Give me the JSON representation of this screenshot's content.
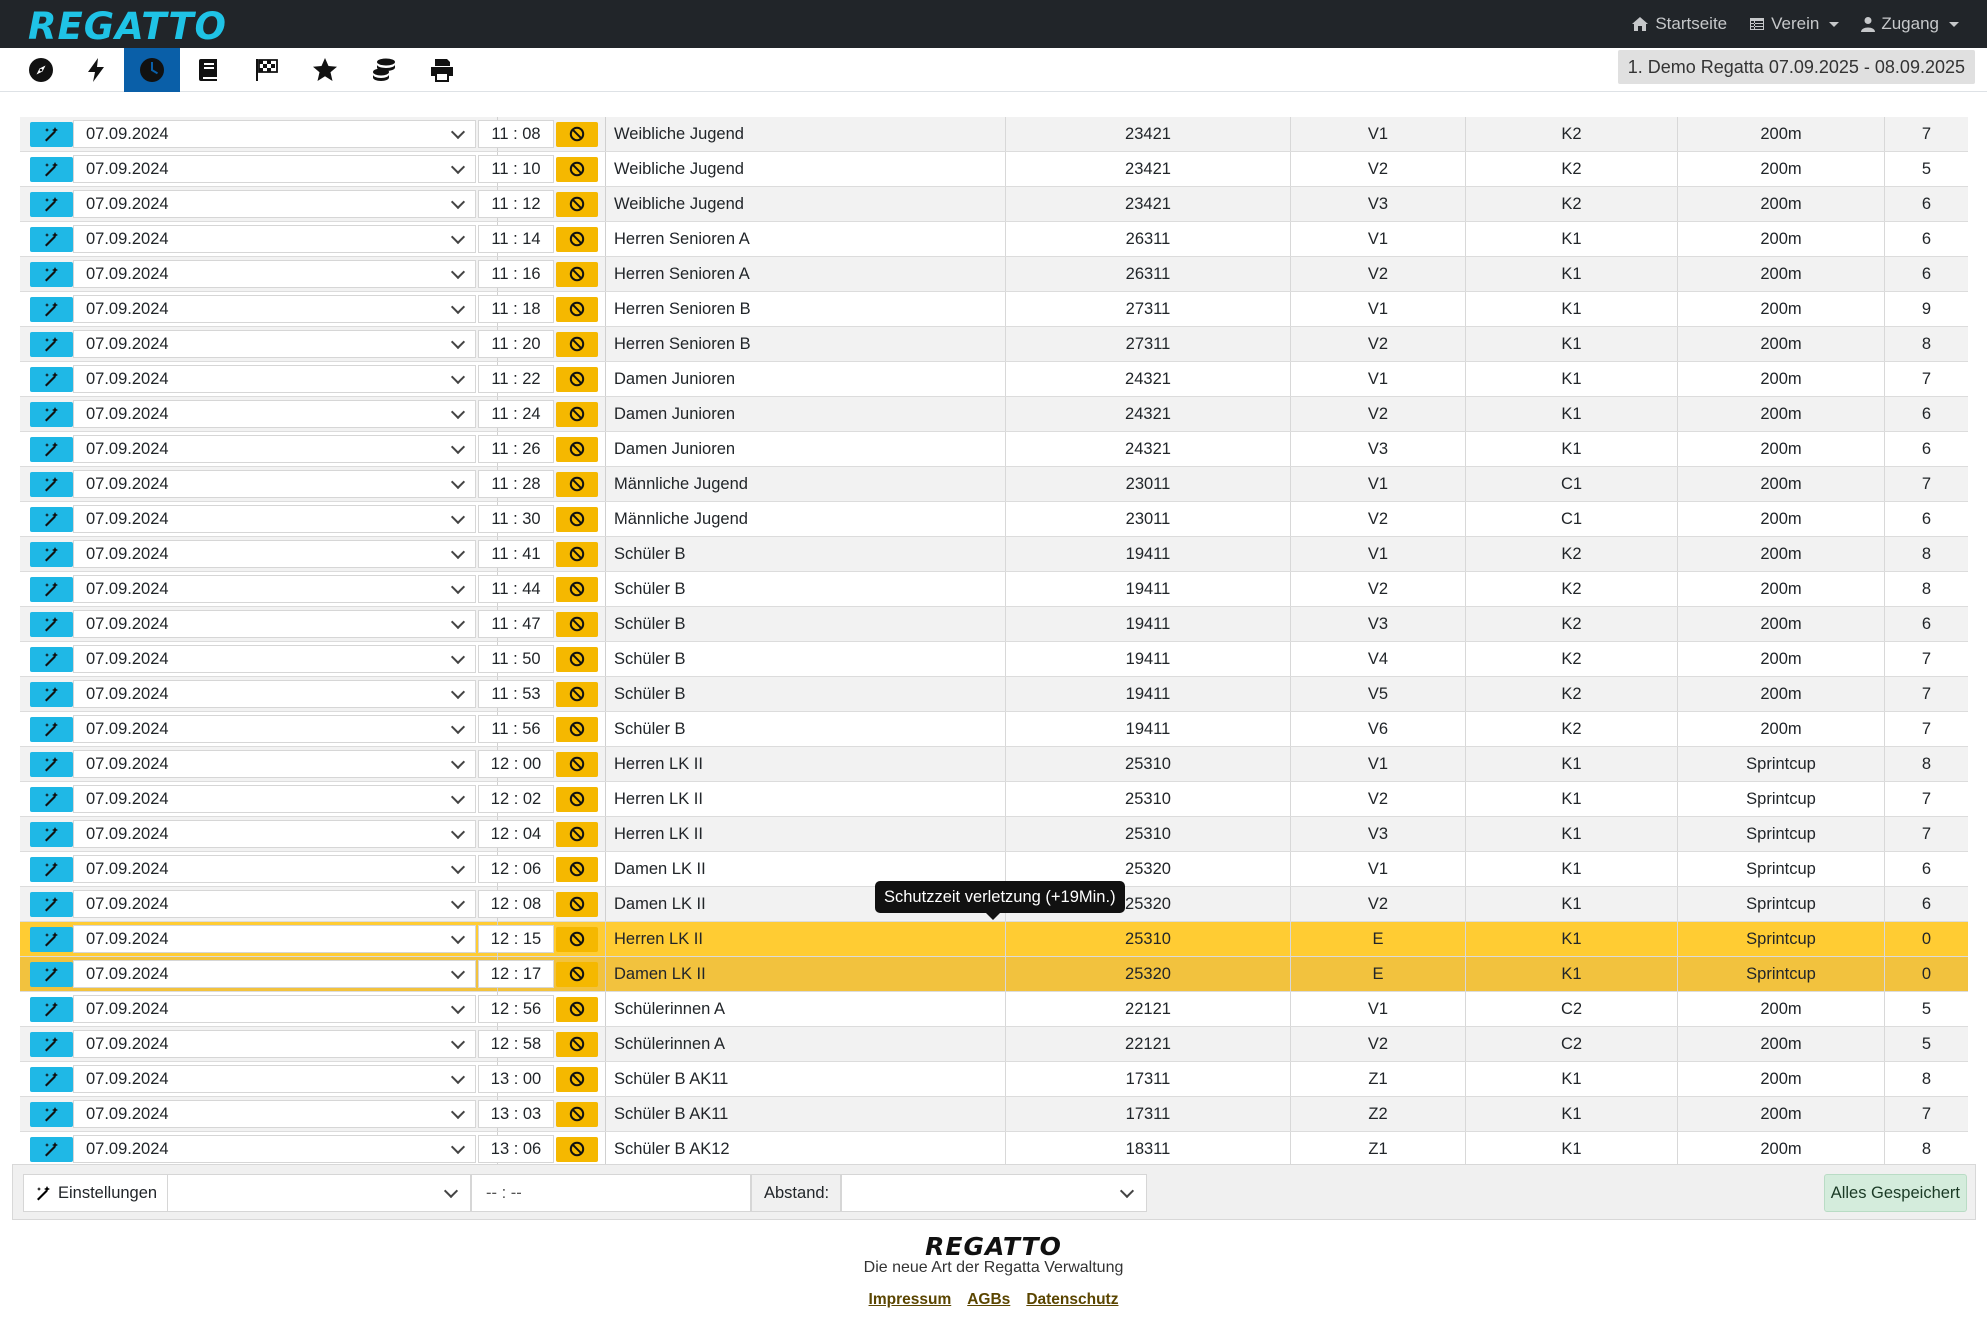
{
  "app": {
    "brand": "REGATTO"
  },
  "nav": {
    "links": [
      {
        "label": "Startseite",
        "icon": "home-icon",
        "has_caret": false
      },
      {
        "label": "Verein",
        "icon": "table-icon",
        "has_caret": true
      },
      {
        "label": "Zugang",
        "icon": "user-icon",
        "has_caret": true
      }
    ]
  },
  "toolbar": {
    "icons": [
      "compass-icon",
      "bolt-icon",
      "clock-icon",
      "book-icon",
      "checkered-flag-icon",
      "star-icon",
      "coins-icon",
      "print-icon"
    ],
    "active_index": 2,
    "regatta_label": "1. Demo Regatta 07.09.2025 - 08.09.2025"
  },
  "rows": [
    {
      "date": "07.09.2024",
      "time": "11 : 08",
      "name": "Weibliche Jugend",
      "number": "23421",
      "lauf": "V1",
      "klasse": "K2",
      "distance": "200m",
      "count": "7"
    },
    {
      "date": "07.09.2024",
      "time": "11 : 10",
      "name": "Weibliche Jugend",
      "number": "23421",
      "lauf": "V2",
      "klasse": "K2",
      "distance": "200m",
      "count": "5"
    },
    {
      "date": "07.09.2024",
      "time": "11 : 12",
      "name": "Weibliche Jugend",
      "number": "23421",
      "lauf": "V3",
      "klasse": "K2",
      "distance": "200m",
      "count": "6"
    },
    {
      "date": "07.09.2024",
      "time": "11 : 14",
      "name": "Herren Senioren A",
      "number": "26311",
      "lauf": "V1",
      "klasse": "K1",
      "distance": "200m",
      "count": "6"
    },
    {
      "date": "07.09.2024",
      "time": "11 : 16",
      "name": "Herren Senioren A",
      "number": "26311",
      "lauf": "V2",
      "klasse": "K1",
      "distance": "200m",
      "count": "6"
    },
    {
      "date": "07.09.2024",
      "time": "11 : 18",
      "name": "Herren Senioren B",
      "number": "27311",
      "lauf": "V1",
      "klasse": "K1",
      "distance": "200m",
      "count": "9"
    },
    {
      "date": "07.09.2024",
      "time": "11 : 20",
      "name": "Herren Senioren B",
      "number": "27311",
      "lauf": "V2",
      "klasse": "K1",
      "distance": "200m",
      "count": "8"
    },
    {
      "date": "07.09.2024",
      "time": "11 : 22",
      "name": "Damen Junioren",
      "number": "24321",
      "lauf": "V1",
      "klasse": "K1",
      "distance": "200m",
      "count": "7"
    },
    {
      "date": "07.09.2024",
      "time": "11 : 24",
      "name": "Damen Junioren",
      "number": "24321",
      "lauf": "V2",
      "klasse": "K1",
      "distance": "200m",
      "count": "6"
    },
    {
      "date": "07.09.2024",
      "time": "11 : 26",
      "name": "Damen Junioren",
      "number": "24321",
      "lauf": "V3",
      "klasse": "K1",
      "distance": "200m",
      "count": "6"
    },
    {
      "date": "07.09.2024",
      "time": "11 : 28",
      "name": "Männliche Jugend",
      "number": "23011",
      "lauf": "V1",
      "klasse": "C1",
      "distance": "200m",
      "count": "7"
    },
    {
      "date": "07.09.2024",
      "time": "11 : 30",
      "name": "Männliche Jugend",
      "number": "23011",
      "lauf": "V2",
      "klasse": "C1",
      "distance": "200m",
      "count": "6"
    },
    {
      "date": "07.09.2024",
      "time": "11 : 41",
      "name": "Schüler B",
      "number": "19411",
      "lauf": "V1",
      "klasse": "K2",
      "distance": "200m",
      "count": "8"
    },
    {
      "date": "07.09.2024",
      "time": "11 : 44",
      "name": "Schüler B",
      "number": "19411",
      "lauf": "V2",
      "klasse": "K2",
      "distance": "200m",
      "count": "8"
    },
    {
      "date": "07.09.2024",
      "time": "11 : 47",
      "name": "Schüler B",
      "number": "19411",
      "lauf": "V3",
      "klasse": "K2",
      "distance": "200m",
      "count": "6"
    },
    {
      "date": "07.09.2024",
      "time": "11 : 50",
      "name": "Schüler B",
      "number": "19411",
      "lauf": "V4",
      "klasse": "K2",
      "distance": "200m",
      "count": "7"
    },
    {
      "date": "07.09.2024",
      "time": "11 : 53",
      "name": "Schüler B",
      "number": "19411",
      "lauf": "V5",
      "klasse": "K2",
      "distance": "200m",
      "count": "7"
    },
    {
      "date": "07.09.2024",
      "time": "11 : 56",
      "name": "Schüler B",
      "number": "19411",
      "lauf": "V6",
      "klasse": "K2",
      "distance": "200m",
      "count": "7"
    },
    {
      "date": "07.09.2024",
      "time": "12 : 00",
      "name": "Herren LK II",
      "number": "25310",
      "lauf": "V1",
      "klasse": "K1",
      "distance": "Sprintcup",
      "count": "8"
    },
    {
      "date": "07.09.2024",
      "time": "12 : 02",
      "name": "Herren LK II",
      "number": "25310",
      "lauf": "V2",
      "klasse": "K1",
      "distance": "Sprintcup",
      "count": "7"
    },
    {
      "date": "07.09.2024",
      "time": "12 : 04",
      "name": "Herren LK II",
      "number": "25310",
      "lauf": "V3",
      "klasse": "K1",
      "distance": "Sprintcup",
      "count": "7"
    },
    {
      "date": "07.09.2024",
      "time": "12 : 06",
      "name": "Damen LK II",
      "number": "25320",
      "lauf": "V1",
      "klasse": "K1",
      "distance": "Sprintcup",
      "count": "6"
    },
    {
      "date": "07.09.2024",
      "time": "12 : 08",
      "name": "Damen LK II",
      "number": "25320",
      "lauf": "V2",
      "klasse": "K1",
      "distance": "Sprintcup",
      "count": "6"
    },
    {
      "date": "07.09.2024",
      "time": "12 : 15",
      "name": "Herren LK II",
      "number": "25310",
      "lauf": "E",
      "klasse": "K1",
      "distance": "Sprintcup",
      "count": "0",
      "highlight": "hl1"
    },
    {
      "date": "07.09.2024",
      "time": "12 : 17",
      "name": "Damen LK II",
      "number": "25320",
      "lauf": "E",
      "klasse": "K1",
      "distance": "Sprintcup",
      "count": "0",
      "highlight": "hl2"
    },
    {
      "date": "07.09.2024",
      "time": "12 : 56",
      "name": "Schülerinnen A",
      "number": "22121",
      "lauf": "V1",
      "klasse": "C2",
      "distance": "200m",
      "count": "5"
    },
    {
      "date": "07.09.2024",
      "time": "12 : 58",
      "name": "Schülerinnen A",
      "number": "22121",
      "lauf": "V2",
      "klasse": "C2",
      "distance": "200m",
      "count": "5"
    },
    {
      "date": "07.09.2024",
      "time": "13 : 00",
      "name": "Schüler B AK11",
      "number": "17311",
      "lauf": "Z1",
      "klasse": "K1",
      "distance": "200m",
      "count": "8"
    },
    {
      "date": "07.09.2024",
      "time": "13 : 03",
      "name": "Schüler B AK11",
      "number": "17311",
      "lauf": "Z2",
      "klasse": "K1",
      "distance": "200m",
      "count": "7"
    },
    {
      "date": "07.09.2024",
      "time": "13 : 06",
      "name": "Schüler B AK12",
      "number": "18311",
      "lauf": "Z1",
      "klasse": "K1",
      "distance": "200m",
      "count": "8"
    }
  ],
  "tooltip": {
    "text": "Schutzzeit verletzung (+19Min.)"
  },
  "settings": {
    "button_label": "Einstellungen",
    "time_placeholder": "-- : --",
    "distance_label": "Abstand:",
    "save_label": "Alles Gespeichert"
  },
  "footer": {
    "brand": "REGATTO",
    "tagline": "Die neue Art der Regatta Verwaltung",
    "links": [
      "Impressum",
      "AGBs",
      "Datenschutz"
    ]
  },
  "colors": {
    "navbar": "#212529",
    "brand": "#1fc3e6",
    "wand_button": "#1fb8e6",
    "ban_button": "#f5b800",
    "highlight": "#ffcc33",
    "active_tool": "#0a5fa8"
  }
}
